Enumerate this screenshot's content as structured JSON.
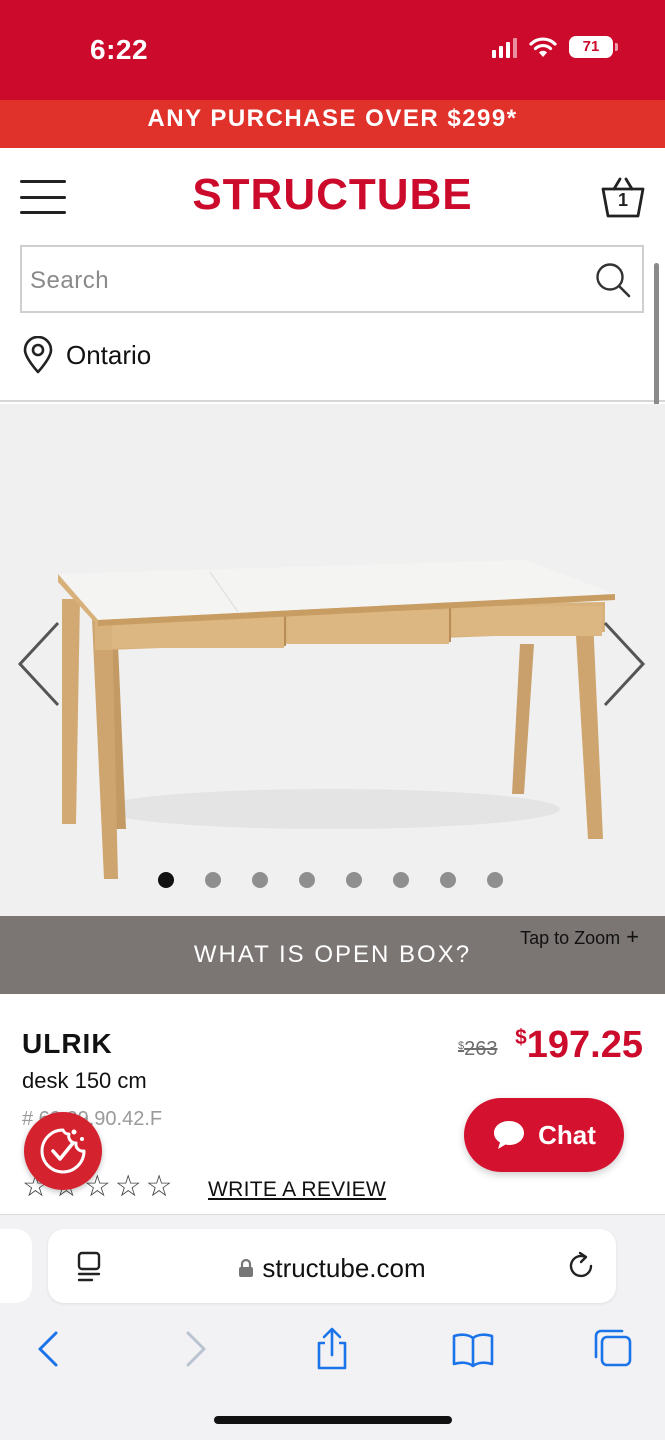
{
  "status_bar": {
    "time": "6:22",
    "battery": "71"
  },
  "promo": {
    "text": "ANY PURCHASE OVER $299*"
  },
  "header": {
    "logo": "STRUCTUBE",
    "cart_count": "1"
  },
  "search": {
    "placeholder": "Search"
  },
  "location": {
    "label": "Ontario"
  },
  "gallery": {
    "dot_count": 8,
    "active_index": 0
  },
  "open_box": {
    "label": "WHAT IS OPEN BOX?",
    "zoom_hint": "Tap to Zoom",
    "zoom_plus": "+"
  },
  "product": {
    "name": "ULRIK",
    "description": "desk 150 cm",
    "sku": "# 60.29.90.42.F",
    "price_old_symbol": "$",
    "price_old": "263",
    "price_symbol": "$",
    "price": "197.25",
    "stars": [
      "☆",
      "☆",
      "☆",
      "☆",
      "☆"
    ],
    "write_review": "WRITE A REVIEW"
  },
  "chat": {
    "label": "Chat"
  },
  "browser": {
    "url": "structube.com"
  },
  "colors": {
    "brand_red": "#cc0a2b",
    "promo_red": "#e0312b",
    "open_box_bar": "#7b7574",
    "ios_blue": "#1a73e8"
  }
}
